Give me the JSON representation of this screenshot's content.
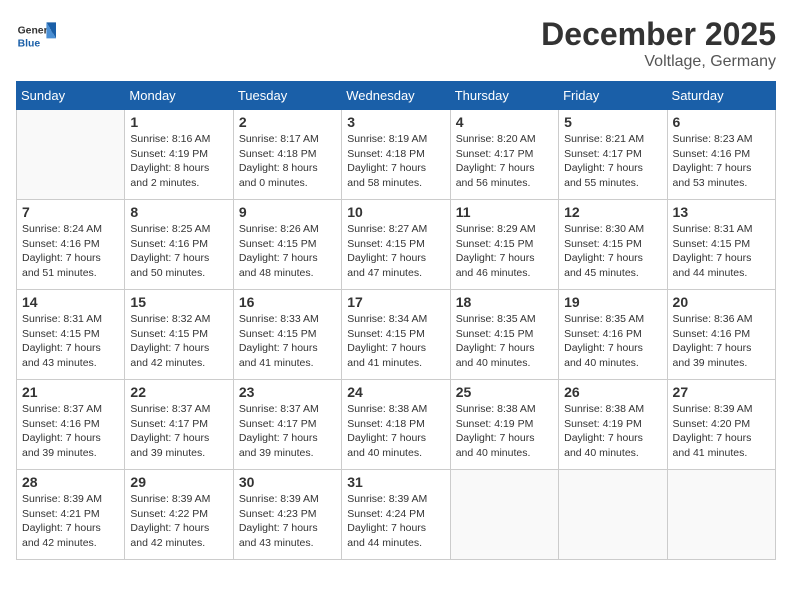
{
  "header": {
    "logo_general": "General",
    "logo_blue": "Blue",
    "month_title": "December 2025",
    "location": "Voltlage, Germany"
  },
  "weekdays": [
    "Sunday",
    "Monday",
    "Tuesday",
    "Wednesday",
    "Thursday",
    "Friday",
    "Saturday"
  ],
  "weeks": [
    [
      {
        "day": "",
        "text": ""
      },
      {
        "day": "1",
        "text": "Sunrise: 8:16 AM\nSunset: 4:19 PM\nDaylight: 8 hours\nand 2 minutes."
      },
      {
        "day": "2",
        "text": "Sunrise: 8:17 AM\nSunset: 4:18 PM\nDaylight: 8 hours\nand 0 minutes."
      },
      {
        "day": "3",
        "text": "Sunrise: 8:19 AM\nSunset: 4:18 PM\nDaylight: 7 hours\nand 58 minutes."
      },
      {
        "day": "4",
        "text": "Sunrise: 8:20 AM\nSunset: 4:17 PM\nDaylight: 7 hours\nand 56 minutes."
      },
      {
        "day": "5",
        "text": "Sunrise: 8:21 AM\nSunset: 4:17 PM\nDaylight: 7 hours\nand 55 minutes."
      },
      {
        "day": "6",
        "text": "Sunrise: 8:23 AM\nSunset: 4:16 PM\nDaylight: 7 hours\nand 53 minutes."
      }
    ],
    [
      {
        "day": "7",
        "text": "Sunrise: 8:24 AM\nSunset: 4:16 PM\nDaylight: 7 hours\nand 51 minutes."
      },
      {
        "day": "8",
        "text": "Sunrise: 8:25 AM\nSunset: 4:16 PM\nDaylight: 7 hours\nand 50 minutes."
      },
      {
        "day": "9",
        "text": "Sunrise: 8:26 AM\nSunset: 4:15 PM\nDaylight: 7 hours\nand 48 minutes."
      },
      {
        "day": "10",
        "text": "Sunrise: 8:27 AM\nSunset: 4:15 PM\nDaylight: 7 hours\nand 47 minutes."
      },
      {
        "day": "11",
        "text": "Sunrise: 8:29 AM\nSunset: 4:15 PM\nDaylight: 7 hours\nand 46 minutes."
      },
      {
        "day": "12",
        "text": "Sunrise: 8:30 AM\nSunset: 4:15 PM\nDaylight: 7 hours\nand 45 minutes."
      },
      {
        "day": "13",
        "text": "Sunrise: 8:31 AM\nSunset: 4:15 PM\nDaylight: 7 hours\nand 44 minutes."
      }
    ],
    [
      {
        "day": "14",
        "text": "Sunrise: 8:31 AM\nSunset: 4:15 PM\nDaylight: 7 hours\nand 43 minutes."
      },
      {
        "day": "15",
        "text": "Sunrise: 8:32 AM\nSunset: 4:15 PM\nDaylight: 7 hours\nand 42 minutes."
      },
      {
        "day": "16",
        "text": "Sunrise: 8:33 AM\nSunset: 4:15 PM\nDaylight: 7 hours\nand 41 minutes."
      },
      {
        "day": "17",
        "text": "Sunrise: 8:34 AM\nSunset: 4:15 PM\nDaylight: 7 hours\nand 41 minutes."
      },
      {
        "day": "18",
        "text": "Sunrise: 8:35 AM\nSunset: 4:15 PM\nDaylight: 7 hours\nand 40 minutes."
      },
      {
        "day": "19",
        "text": "Sunrise: 8:35 AM\nSunset: 4:16 PM\nDaylight: 7 hours\nand 40 minutes."
      },
      {
        "day": "20",
        "text": "Sunrise: 8:36 AM\nSunset: 4:16 PM\nDaylight: 7 hours\nand 39 minutes."
      }
    ],
    [
      {
        "day": "21",
        "text": "Sunrise: 8:37 AM\nSunset: 4:16 PM\nDaylight: 7 hours\nand 39 minutes."
      },
      {
        "day": "22",
        "text": "Sunrise: 8:37 AM\nSunset: 4:17 PM\nDaylight: 7 hours\nand 39 minutes."
      },
      {
        "day": "23",
        "text": "Sunrise: 8:37 AM\nSunset: 4:17 PM\nDaylight: 7 hours\nand 39 minutes."
      },
      {
        "day": "24",
        "text": "Sunrise: 8:38 AM\nSunset: 4:18 PM\nDaylight: 7 hours\nand 40 minutes."
      },
      {
        "day": "25",
        "text": "Sunrise: 8:38 AM\nSunset: 4:19 PM\nDaylight: 7 hours\nand 40 minutes."
      },
      {
        "day": "26",
        "text": "Sunrise: 8:38 AM\nSunset: 4:19 PM\nDaylight: 7 hours\nand 40 minutes."
      },
      {
        "day": "27",
        "text": "Sunrise: 8:39 AM\nSunset: 4:20 PM\nDaylight: 7 hours\nand 41 minutes."
      }
    ],
    [
      {
        "day": "28",
        "text": "Sunrise: 8:39 AM\nSunset: 4:21 PM\nDaylight: 7 hours\nand 42 minutes."
      },
      {
        "day": "29",
        "text": "Sunrise: 8:39 AM\nSunset: 4:22 PM\nDaylight: 7 hours\nand 42 minutes."
      },
      {
        "day": "30",
        "text": "Sunrise: 8:39 AM\nSunset: 4:23 PM\nDaylight: 7 hours\nand 43 minutes."
      },
      {
        "day": "31",
        "text": "Sunrise: 8:39 AM\nSunset: 4:24 PM\nDaylight: 7 hours\nand 44 minutes."
      },
      {
        "day": "",
        "text": ""
      },
      {
        "day": "",
        "text": ""
      },
      {
        "day": "",
        "text": ""
      }
    ]
  ]
}
